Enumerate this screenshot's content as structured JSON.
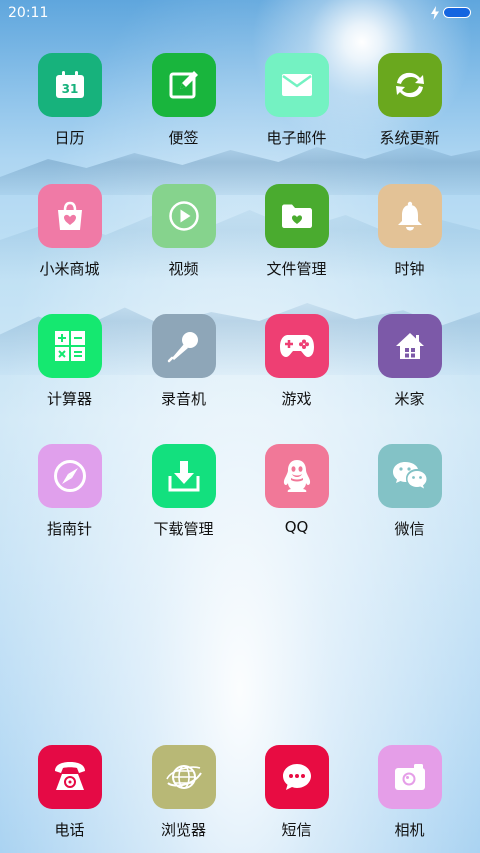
{
  "status_bar": {
    "time": "20:11"
  },
  "apps": [
    {
      "label": "日历",
      "color": "#17b27c",
      "icon": "calendar-icon",
      "icon_text": "31"
    },
    {
      "label": "便签",
      "color": "#19b53d",
      "icon": "note-edit-icon"
    },
    {
      "label": "电子邮件",
      "color": "#74f2c2",
      "icon": "mail-icon"
    },
    {
      "label": "系统更新",
      "color": "#6aa81e",
      "icon": "refresh-icon"
    },
    {
      "label": "小米商城",
      "color": "#f07aa6",
      "icon": "shopping-bag-icon"
    },
    {
      "label": "视频",
      "color": "#86d38d",
      "icon": "play-icon"
    },
    {
      "label": "文件管理",
      "color": "#4aab2f",
      "icon": "folder-icon"
    },
    {
      "label": "时钟",
      "color": "#e3c296",
      "icon": "bell-icon"
    },
    {
      "label": "计算器",
      "color": "#15e870",
      "icon": "calculator-icon"
    },
    {
      "label": "录音机",
      "color": "#8ea6b8",
      "icon": "microphone-icon"
    },
    {
      "label": "游戏",
      "color": "#ee3f73",
      "icon": "gamepad-icon"
    },
    {
      "label": "米家",
      "color": "#7c59a8",
      "icon": "home-icon"
    },
    {
      "label": "指南针",
      "color": "#e0a0ec",
      "icon": "compass-icon"
    },
    {
      "label": "下载管理",
      "color": "#13e07e",
      "icon": "download-icon"
    },
    {
      "label": "QQ",
      "color": "#f17898",
      "icon": "penguin-icon"
    },
    {
      "label": "微信",
      "color": "#83c2c6",
      "icon": "chat-bubbles-icon"
    }
  ],
  "dock": [
    {
      "label": "电话",
      "color": "#e50a45",
      "icon": "phone-icon"
    },
    {
      "label": "浏览器",
      "color": "#b8b876",
      "icon": "globe-icon"
    },
    {
      "label": "短信",
      "color": "#e80c42",
      "icon": "message-icon"
    },
    {
      "label": "相机",
      "color": "#e59ee8",
      "icon": "camera-icon"
    }
  ]
}
